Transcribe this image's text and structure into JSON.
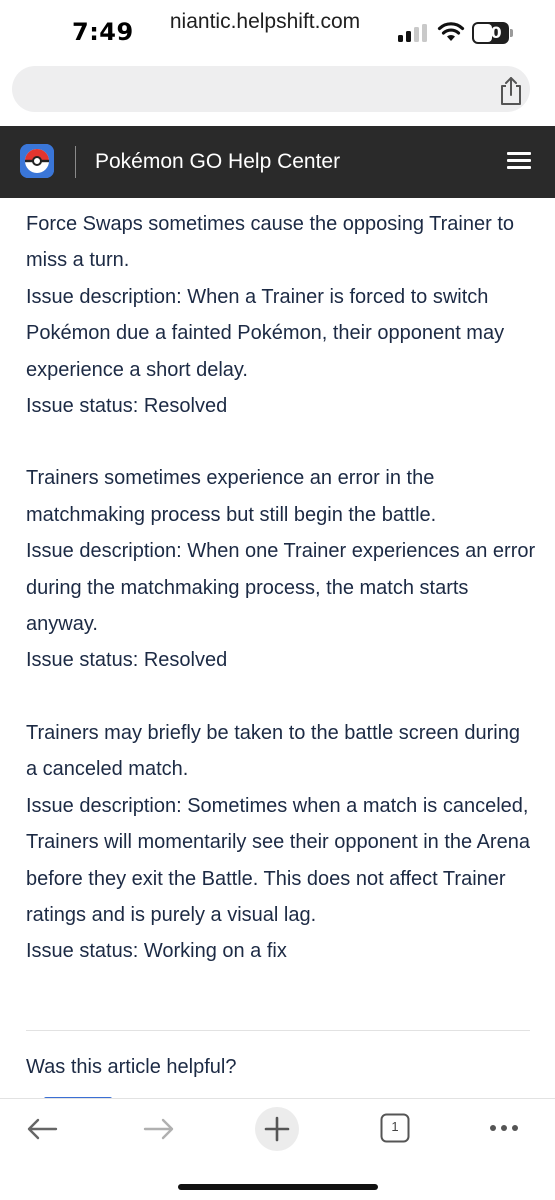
{
  "status_bar": {
    "time": "7:49",
    "battery": "50"
  },
  "browser": {
    "url": "niantic.helpshift.com"
  },
  "site": {
    "title": "Pokémon GO Help Center"
  },
  "issues": [
    {
      "title": "Force Swaps sometimes cause the opposing Trainer to miss a turn.",
      "description": "Issue description: When a Trainer is forced to switch Pokémon due a fainted Pokémon, their opponent may experience a short delay.",
      "status": "Issue status: Resolved"
    },
    {
      "title": "Trainers sometimes experience an error in the matchmaking process but still begin the battle.",
      "description": "Issue description: When one Trainer experiences an error during the matchmaking process, the match starts anyway.",
      "status": "Issue status: Resolved"
    },
    {
      "title": "Trainers may briefly be taken to the battle screen during a canceled match.",
      "description": "Issue description: Sometimes when a match is canceled, Trainers will momentarily see their opponent in the Arena before they exit the Battle. This does not affect Trainer ratings and is purely a visual lag.",
      "status": "Issue status: Working on a fix"
    }
  ],
  "feedback": {
    "question": "Was this article helpful?"
  },
  "toolbar": {
    "tab_count": "1"
  },
  "colors": {
    "header_bg": "#2a2a2a",
    "body_text": "#1c2a44",
    "accent": "#3b6fd4"
  },
  "icons": [
    "signal-icon",
    "wifi-icon",
    "battery-icon",
    "share-icon",
    "pokeball-logo-icon",
    "hamburger-menu-icon",
    "back-arrow-icon",
    "forward-arrow-icon",
    "new-tab-icon",
    "tabs-icon",
    "more-icon"
  ]
}
